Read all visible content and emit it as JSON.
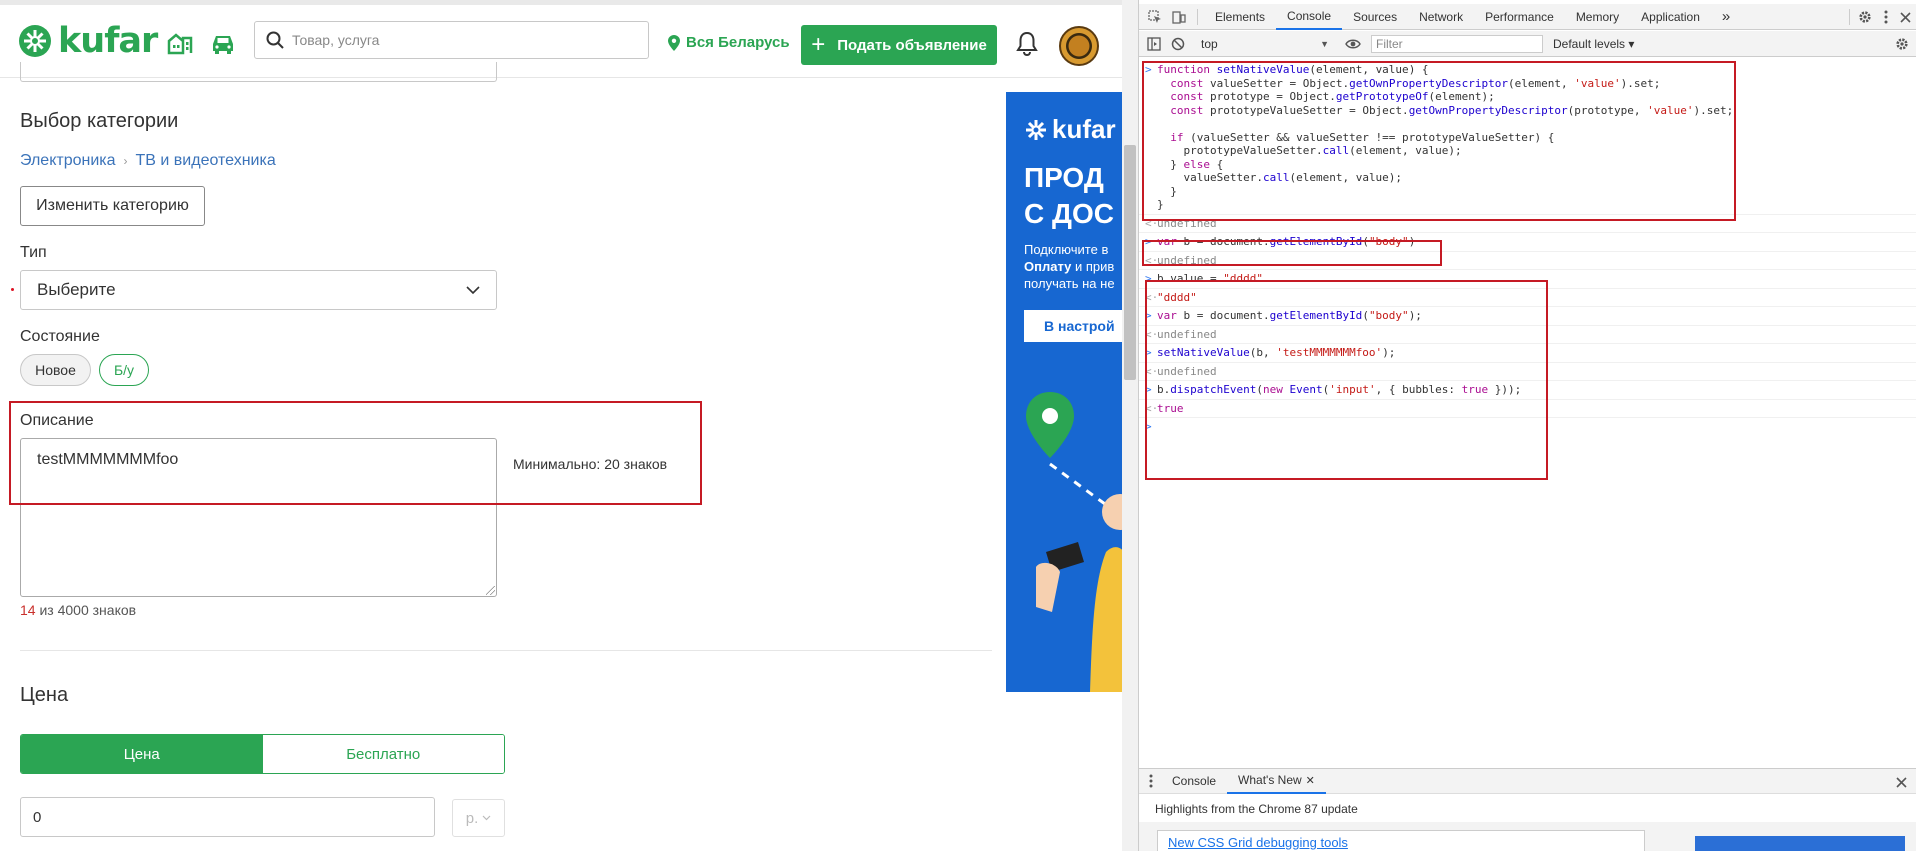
{
  "header": {
    "logo_text": "kufar",
    "search_placeholder": "Товар, услуга",
    "region": "Вся Беларусь",
    "post_button": "Подать объявление"
  },
  "form": {
    "category_title": "Выбор категории",
    "breadcrumb": [
      "Электроника",
      "ТВ и видеотехника"
    ],
    "change_category": "Изменить категорию",
    "type_label": "Тип",
    "type_value": "Выберите",
    "condition_label": "Состояние",
    "condition_options": [
      "Новое",
      "Б/у"
    ],
    "description_label": "Описание",
    "description_value": "testMMMMMMMfoo",
    "min_hint": "Минимально: 20 знаков",
    "counter_num": "14",
    "counter_rest": " из 4000 знаков",
    "price_title": "Цена",
    "price_tabs": [
      "Цена",
      "Бесплатно"
    ],
    "price_value": "0",
    "currency": "р."
  },
  "ad": {
    "logo": "kufar",
    "headline_1": "ПРОД",
    "headline_2": "С ДОС",
    "text_1": "Подключите в",
    "text_2_bold": "Оплату",
    "text_2_rest": " и прив",
    "text_3": "получать на не",
    "button": "В настрой"
  },
  "devtools": {
    "tabs": [
      "Elements",
      "Console",
      "Sources",
      "Network",
      "Performance",
      "Memory",
      "Application"
    ],
    "more": "»",
    "context": "top",
    "filter_placeholder": "Filter",
    "levels": "Default levels ▾",
    "drawer_tabs": [
      "Console",
      "What's New"
    ],
    "whatsnew_title": "Highlights from the Chrome 87 update",
    "card_title": "New CSS Grid debugging tools"
  },
  "console_lines": {
    "undefined": "undefined",
    "dddd_out": "\"dddd\"",
    "true_out": "true"
  },
  "colors": {
    "brand_green": "#2ba553",
    "link_blue": "#3b73b9",
    "annotation_red": "#c51a24",
    "ad_blue": "#1767d1"
  }
}
